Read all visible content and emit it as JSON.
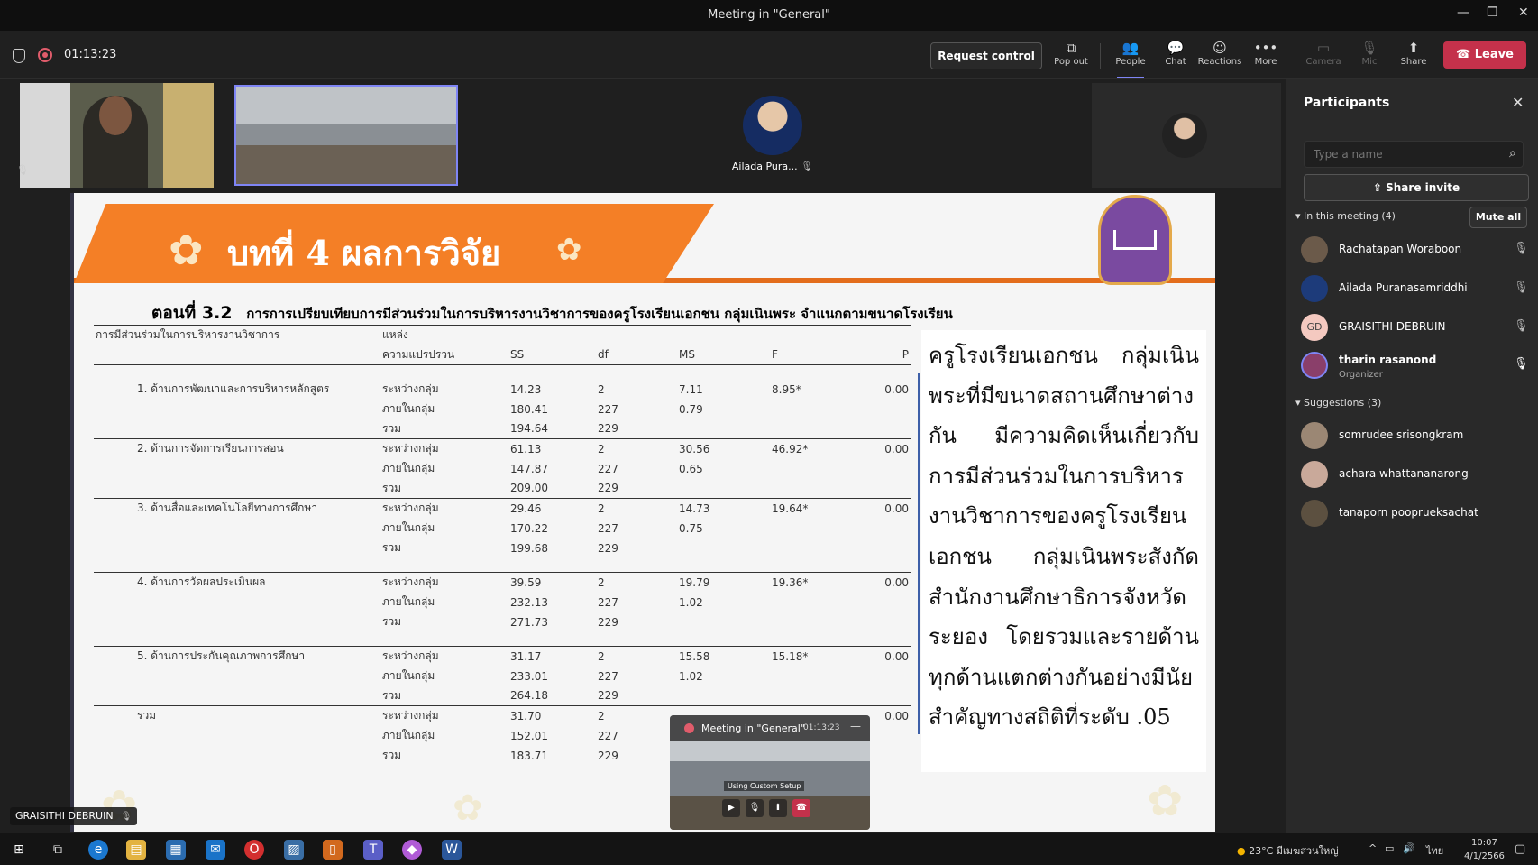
{
  "window": {
    "title": "Meeting in \"General\""
  },
  "toolbar": {
    "timer": "01:13:23",
    "request_control": "Request control",
    "pop_out": "Pop out",
    "people": "People",
    "chat": "Chat",
    "reactions": "Reactions",
    "more": "More",
    "camera": "Camera",
    "mic": "Mic",
    "share": "Share",
    "leave": "Leave"
  },
  "video": {
    "ailada_name": "Ailada Pura...",
    "bottom_tag": "GRAISITHI DEBRUIN"
  },
  "slide": {
    "title": "บทที่ 4 ผลการวิจัย",
    "subtitle_num": "ตอนที่ 3.2",
    "subtitle_text": "การการเปรียบเทียบการมีส่วนร่วมในการบริหารงานวิชาการของครูโรงเรียนเอกชน กลุ่มเนินพระ จำแนกตามขนาดโรงเรียน",
    "table": {
      "head_row1": [
        "การมีส่วนร่วมในการบริหารงานวิชาการ",
        "แหล่ง",
        "",
        "",
        "",
        "",
        ""
      ],
      "head_row2": [
        "",
        "ความแปรปรวน",
        "SS",
        "df",
        "MS",
        "F",
        "P"
      ],
      "groups": [
        {
          "category": "1. ด้านการพัฒนาและการบริหารหลักสูตร",
          "rows": [
            [
              "ระหว่างกลุ่ม",
              "14.23",
              "2",
              "7.11",
              "8.95*",
              "0.00"
            ],
            [
              "ภายในกลุ่ม",
              "180.41",
              "227",
              "0.79",
              "",
              ""
            ],
            [
              "รวม",
              "194.64",
              "229",
              "",
              "",
              ""
            ]
          ]
        },
        {
          "category": "2. ด้านการจัดการเรียนการสอน",
          "rows": [
            [
              "ระหว่างกลุ่ม",
              "61.13",
              "2",
              "30.56",
              "46.92*",
              "0.00"
            ],
            [
              "ภายในกลุ่ม",
              "147.87",
              "227",
              "0.65",
              "",
              ""
            ],
            [
              "รวม",
              "209.00",
              "229",
              "",
              "",
              ""
            ]
          ]
        },
        {
          "category": "3. ด้านสื่อและเทคโนโลยีทางการศึกษา",
          "rows": [
            [
              "ระหว่างกลุ่ม",
              "29.46",
              "2",
              "14.73",
              "19.64*",
              "0.00"
            ],
            [
              "ภายในกลุ่ม",
              "170.22",
              "227",
              "0.75",
              "",
              ""
            ],
            [
              "รวม",
              "199.68",
              "229",
              "",
              "",
              ""
            ]
          ]
        },
        {
          "category": "4. ด้านการวัดผลประเมินผล",
          "rows": [
            [
              "ระหว่างกลุ่ม",
              "39.59",
              "2",
              "19.79",
              "19.36*",
              "0.00"
            ],
            [
              "ภายในกลุ่ม",
              "232.13",
              "227",
              "1.02",
              "",
              ""
            ],
            [
              "รวม",
              "271.73",
              "229",
              "",
              "",
              ""
            ]
          ]
        },
        {
          "category": "5. ด้านการประกันคุณภาพการศึกษา",
          "rows": [
            [
              "ระหว่างกลุ่ม",
              "31.17",
              "2",
              "15.58",
              "15.18*",
              "0.00"
            ],
            [
              "ภายในกลุ่ม",
              "233.01",
              "227",
              "1.02",
              "",
              ""
            ],
            [
              "รวม",
              "264.18",
              "229",
              "",
              "",
              ""
            ]
          ]
        },
        {
          "category": "รวม",
          "rows": [
            [
              "ระหว่างกลุ่ม",
              "31.70",
              "2",
              "",
              "",
              "0.00"
            ],
            [
              "ภายในกลุ่ม",
              "152.01",
              "227",
              "",
              "",
              ""
            ],
            [
              "รวม",
              "183.71",
              "229",
              "",
              "",
              ""
            ]
          ]
        }
      ]
    },
    "summary": "ครูโรงเรียนเอกชน กลุ่มเนินพระที่มีขนาดสถานศึกษาต่างกัน มีความคิดเห็นเกี่ยวกับการมีส่วนร่วมในการบริหารงานวิชาการของครูโรงเรียนเอกชน กลุ่มเนินพระสังกัดสำนักงานศึกษาธิการจังหวัดระยอง โดยรวมและรายด้านทุกด้านแตกต่างกันอย่างมีนัยสำคัญทางสถิติที่ระดับ .05"
  },
  "pip": {
    "title": "Meeting in \"General\"",
    "time": "01:13:23",
    "caption": "Using Custom Setup"
  },
  "panel": {
    "title": "Participants",
    "search_placeholder": "Type a name",
    "share_invite": "Share invite",
    "in_meeting": "In this meeting (4)",
    "mute_all": "Mute all",
    "participants": [
      {
        "name": "Rachatapan Woraboon",
        "role": "",
        "initials": ""
      },
      {
        "name": "Ailada Puranasamriddhi",
        "role": "",
        "initials": ""
      },
      {
        "name": "GRAISITHI DEBRUIN",
        "role": "",
        "initials": "GD"
      },
      {
        "name": "tharin rasanond",
        "role": "Organizer",
        "initials": ""
      }
    ],
    "suggestions_label": "Suggestions (3)",
    "suggestions": [
      {
        "name": "somrudee srisongkram"
      },
      {
        "name": "achara whattananarong"
      },
      {
        "name": "tanaporn pooprueksachat"
      }
    ]
  },
  "taskbar": {
    "weather": "23°C",
    "weather_text": "มีเมฆส่วนใหญ่",
    "lang": "ไทย",
    "time": "10:07",
    "date": "4/1/2566"
  },
  "colors": {
    "accent": "#7f85f5",
    "leave": "#c4314b",
    "banner": "#f47f26"
  }
}
